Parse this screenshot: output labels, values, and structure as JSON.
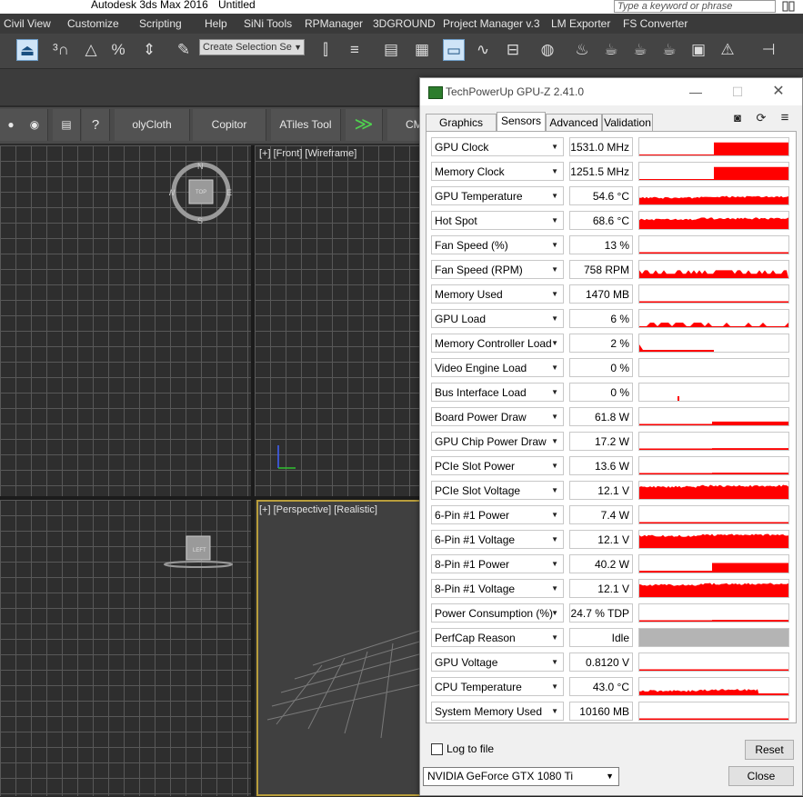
{
  "max": {
    "app_title": "Autodesk 3ds Max 2016",
    "doc_title": "Untitled",
    "search_placeholder": "Type a keyword or phrase",
    "menu": [
      "Civil View",
      "Customize",
      "Scripting",
      "Help",
      "SiNi Tools",
      "RPManager",
      "3DGROUND",
      "Project Manager v.3",
      "LM Exporter",
      "FS Converter"
    ],
    "selection_set": "Create Selection Se",
    "toolbar2": [
      "olyCloth Brushe",
      "Copitor",
      "ATiles Tool",
      "CM"
    ],
    "viewports": {
      "front_label": "[+] [Front] [Wireframe]",
      "persp_label": "[+] [Perspective] [Realistic]",
      "viewcube_top": "TOP",
      "viewcube_left": "LEFT",
      "compass": {
        "n": "N",
        "s": "S",
        "e": "E",
        "w": "W"
      }
    }
  },
  "gpuz": {
    "title": "TechPowerUp GPU-Z 2.41.0",
    "tabs": [
      "Graphics Card",
      "Sensors",
      "Advanced",
      "Validation"
    ],
    "active_tab": "Sensors",
    "sensors": [
      {
        "name": "GPU Clock",
        "value": "1531.0 MHz"
      },
      {
        "name": "Memory Clock",
        "value": "1251.5 MHz"
      },
      {
        "name": "GPU Temperature",
        "value": "54.6 °C"
      },
      {
        "name": "Hot Spot",
        "value": "68.6 °C"
      },
      {
        "name": "Fan Speed (%)",
        "value": "13 %"
      },
      {
        "name": "Fan Speed (RPM)",
        "value": "758 RPM"
      },
      {
        "name": "Memory Used",
        "value": "1470 MB"
      },
      {
        "name": "GPU Load",
        "value": "6 %"
      },
      {
        "name": "Memory Controller Load",
        "value": "2 %"
      },
      {
        "name": "Video Engine Load",
        "value": "0 %"
      },
      {
        "name": "Bus Interface Load",
        "value": "0 %"
      },
      {
        "name": "Board Power Draw",
        "value": "61.8 W"
      },
      {
        "name": "GPU Chip Power Draw",
        "value": "17.2 W"
      },
      {
        "name": "PCIe Slot Power",
        "value": "13.6 W"
      },
      {
        "name": "PCIe Slot Voltage",
        "value": "12.1 V"
      },
      {
        "name": "6-Pin #1 Power",
        "value": "7.4 W"
      },
      {
        "name": "6-Pin #1 Voltage",
        "value": "12.1 V"
      },
      {
        "name": "8-Pin #1 Power",
        "value": "40.2 W"
      },
      {
        "name": "8-Pin #1 Voltage",
        "value": "12.1 V"
      },
      {
        "name": "Power Consumption (%)",
        "value": "24.7 % TDP"
      },
      {
        "name": "PerfCap Reason",
        "value": "Idle"
      },
      {
        "name": "GPU Voltage",
        "value": "0.8120 V"
      },
      {
        "name": "CPU Temperature",
        "value": "43.0 °C"
      },
      {
        "name": "System Memory Used",
        "value": "10160 MB"
      }
    ],
    "log_to_file": "Log to file",
    "reset": "Reset",
    "gpu_name": "NVIDIA GeForce GTX 1080 Ti",
    "close": "Close",
    "graph_color": "#ff0000"
  }
}
